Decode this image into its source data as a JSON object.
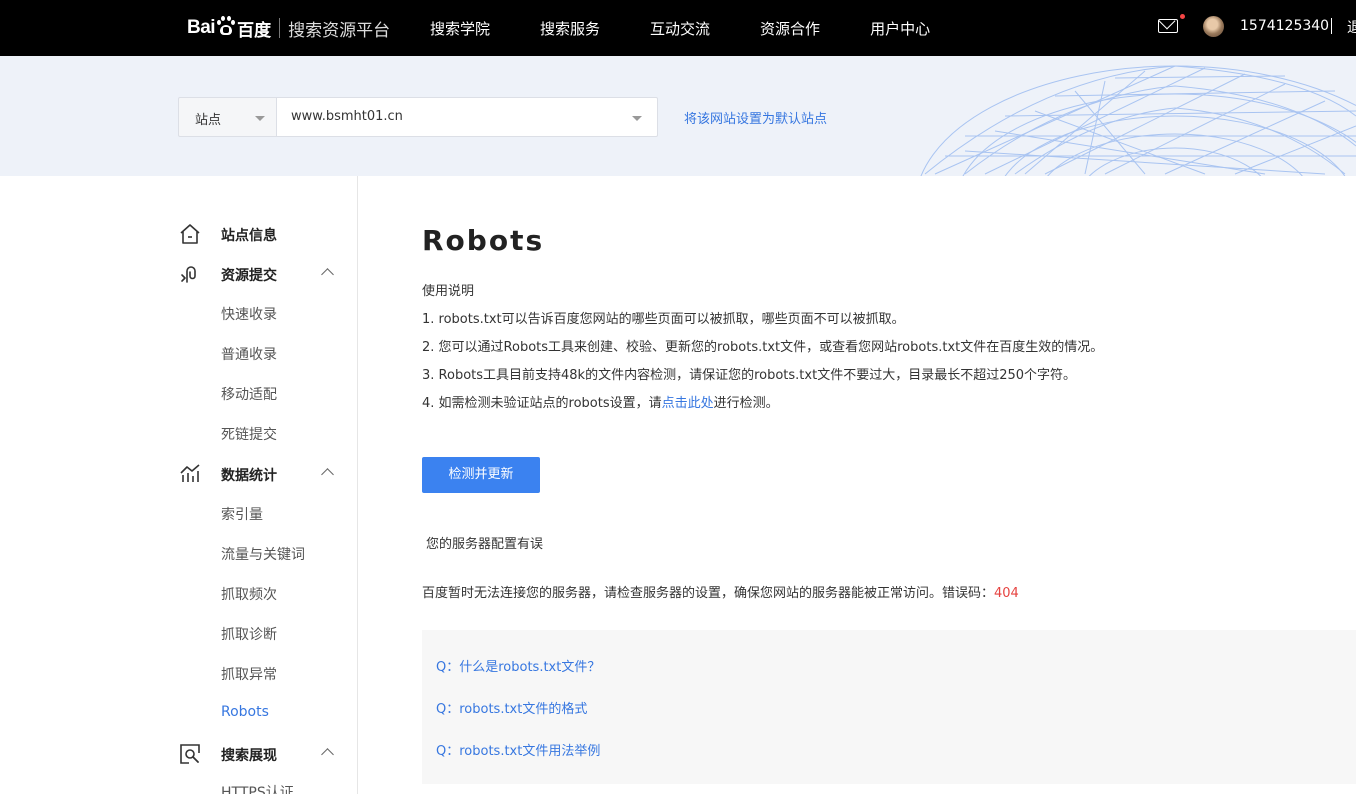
{
  "header": {
    "logo_bai": "Bai",
    "logo_bd": "百度",
    "platform": "搜索资源平台",
    "nav": [
      "搜索学院",
      "搜索服务",
      "互动交流",
      "资源合作",
      "用户中心"
    ],
    "username": "1574125340",
    "extra": "退"
  },
  "site_bar": {
    "type_label": "站点",
    "site_value": "www.bsmht01.cn",
    "set_default_link": "将该网站设置为默认站点"
  },
  "sidebar": {
    "site_info": "站点信息",
    "resource_submit": {
      "label": "资源提交",
      "items": [
        "快速收录",
        "普通收录",
        "移动适配",
        "死链提交"
      ]
    },
    "data_stats": {
      "label": "数据统计",
      "items": [
        "索引量",
        "流量与关键词",
        "抓取频次",
        "抓取诊断",
        "抓取异常",
        "Robots"
      ]
    },
    "search_display": {
      "label": "搜索展现",
      "items": [
        "HTTPS认证"
      ]
    }
  },
  "main": {
    "title": "Robots",
    "usage_heading": "使用说明",
    "line1": "1. robots.txt可以告诉百度您网站的哪些页面可以被抓取，哪些页面不可以被抓取。",
    "line2": "2. 您可以通过Robots工具来创建、校验、更新您的robots.txt文件，或查看您网站robots.txt文件在百度生效的情况。",
    "line3": "3. Robots工具目前支持48k的文件内容检测，请保证您的robots.txt文件不要过大，目录最长不超过250个字符。",
    "line4_prefix": "4. 如需检测未验证站点的robots设置，请",
    "line4_link": "点击此处",
    "line4_suffix": "进行检测。",
    "check_button": "检测并更新",
    "status_text": "您的服务器配置有误",
    "error_text": "百度暂时无法连接您的服务器，请检查服务器的设置，确保您网站的服务器能被正常访问。错误码：",
    "error_code": "404",
    "faq": [
      "Q：什么是robots.txt文件？",
      "Q：robots.txt文件的格式",
      "Q：robots.txt文件用法举例"
    ]
  },
  "colors": {
    "accent": "#3777e0",
    "button": "#3b82f0",
    "error": "#e64340",
    "topbar": "#000000",
    "sitebar_bg": "#eef2f9"
  },
  "icons": {
    "mail": "envelope-icon",
    "site_info": "home-icon",
    "resource_submit": "link-hook-icon",
    "data_stats": "bar-chart-icon",
    "search_display": "search-box-icon"
  }
}
